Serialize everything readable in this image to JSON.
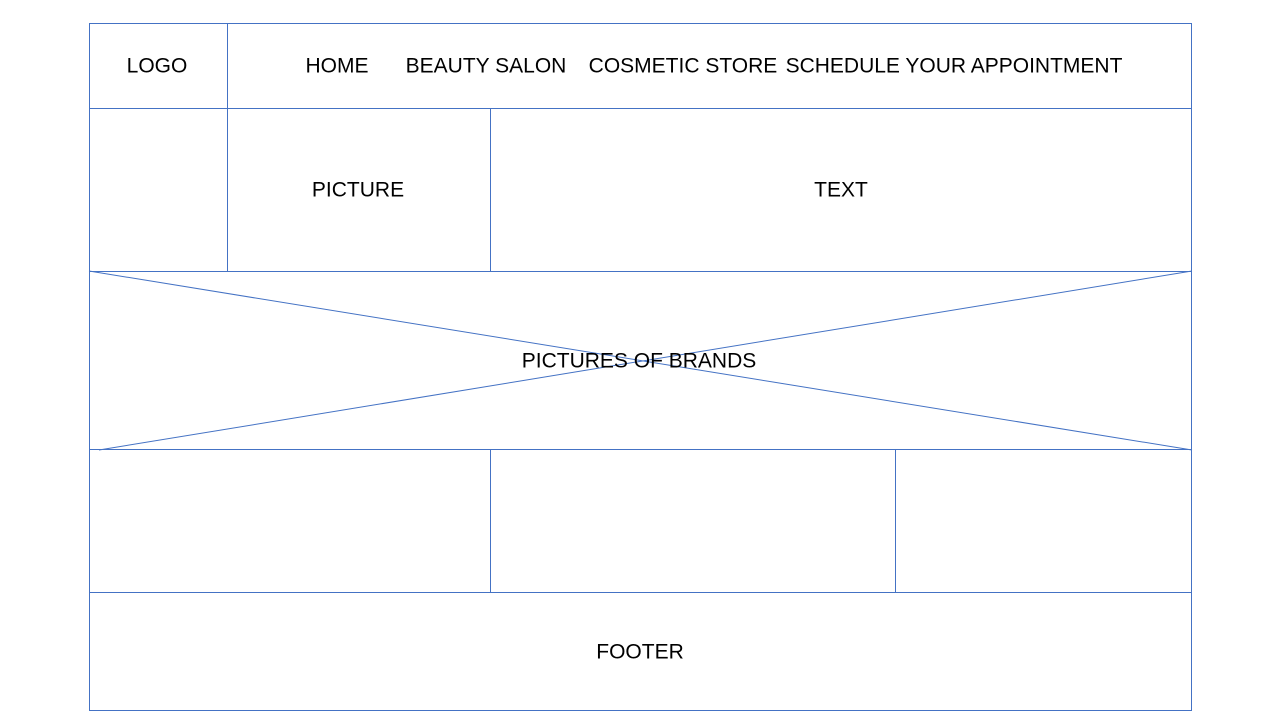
{
  "colors": {
    "wireframe_line": "#4472c4",
    "background": "#ffffff",
    "text": "#000000"
  },
  "header": {
    "logo": "LOGO",
    "nav": [
      "HOME",
      "BEAUTY SALON",
      "COSMETIC STORE",
      "SCHEDULE YOUR APPOINTMENT"
    ]
  },
  "hero": {
    "picture_label": "PICTURE",
    "text_label": "TEXT"
  },
  "brands": {
    "label": "PICTURES OF BRANDS"
  },
  "footer": {
    "label": "FOOTER"
  }
}
